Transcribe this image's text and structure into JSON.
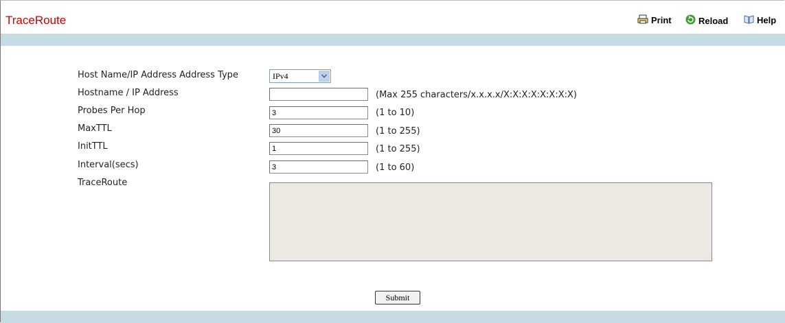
{
  "page": {
    "title": "TraceRoute"
  },
  "toolbar": {
    "print_label": "Print",
    "reload_label": "Reload",
    "help_label": "Help"
  },
  "form": {
    "address_type": {
      "label": "Host Name/IP Address Address Type",
      "value": "IPv4"
    },
    "hostname": {
      "label": "Hostname / IP Address",
      "value": "",
      "hint": "(Max 255 characters/x.x.x.x/X:X:X:X:X:X:X:X)"
    },
    "probes": {
      "label": "Probes Per Hop",
      "value": "3",
      "hint": "(1 to 10)"
    },
    "maxttl": {
      "label": "MaxTTL",
      "value": "30",
      "hint": "(1 to 255)"
    },
    "initttl": {
      "label": "InitTTL",
      "value": "1",
      "hint": "(1 to 255)"
    },
    "interval": {
      "label": "Interval(secs)",
      "value": "3",
      "hint": "(1 to 60)"
    },
    "traceroute": {
      "label": "TraceRoute",
      "value": ""
    },
    "submit_label": "Submit"
  },
  "colors": {
    "title": "#cc0000",
    "bar": "#c7dbe5",
    "result_bg": "#ece9e2"
  },
  "icons": {
    "print": "printer-icon",
    "reload": "reload-icon",
    "help": "help-book-icon",
    "dropdown": "chevron-down-icon"
  }
}
